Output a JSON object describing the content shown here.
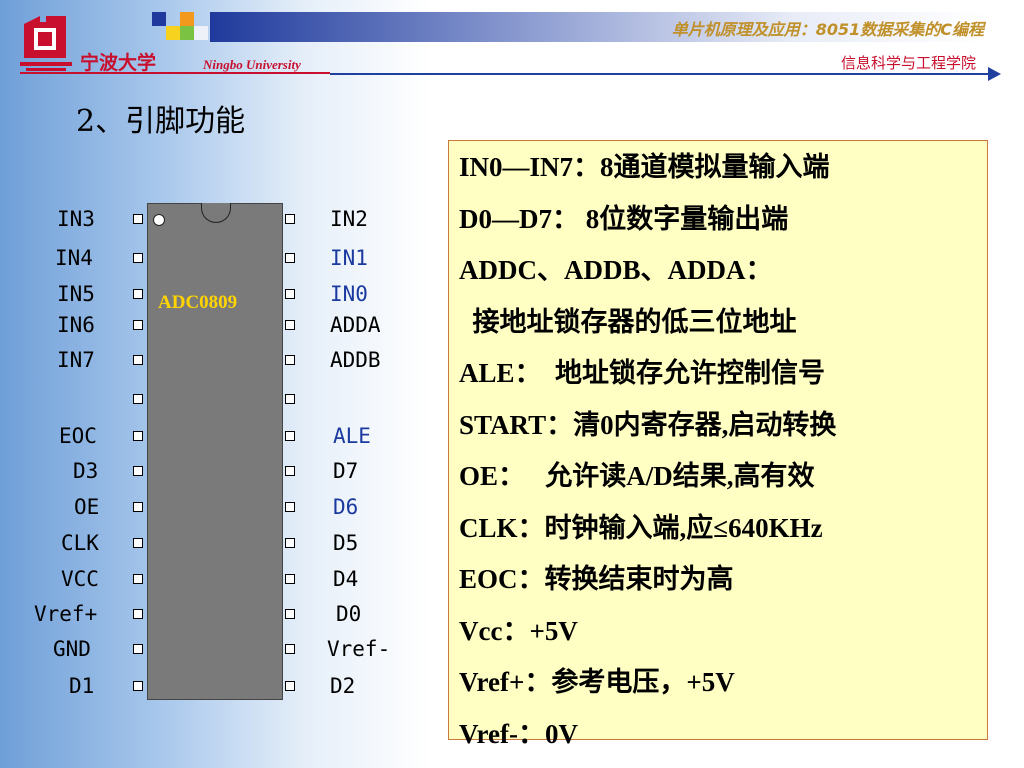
{
  "header": {
    "university_cn": "宁波大学",
    "university_en": "Ningbo University",
    "course_title": "单片机原理及应用：8051数据采集的C编程",
    "college": "信息科学与工程学院",
    "colors": {
      "red": "#c8102e",
      "blue": "#2040a0",
      "gold": "#c0902a"
    }
  },
  "title": "2、引脚功能",
  "chip": {
    "name": "ADC0809",
    "left_pins": [
      "IN3",
      "IN4",
      "IN5",
      "IN6",
      "IN7",
      "",
      "EOC",
      "D3",
      "OE",
      "CLK",
      "VCC",
      "Vref+",
      "GND",
      "D1"
    ],
    "right_pins": [
      "IN2",
      "IN1",
      "IN0",
      "ADDA",
      "ADDB",
      "",
      "ALE",
      "D7",
      "D6",
      "D5",
      "D4",
      "D0",
      "Vref-",
      "D2"
    ]
  },
  "descriptions": [
    "IN0—IN7：8通道模拟量输入端",
    "D0—D7：  8位数字量输出端",
    "ADDC、ADDB、ADDA：",
    "  接地址锁存器的低三位地址",
    "ALE：  地址锁存允许控制信号",
    "START：清0内寄存器,启动转换",
    "OE：   允许读A/D结果,高有效",
    "CLK：时钟输入端,应≤640KHz",
    "EOC：转换结束时为高",
    "Vcc：+5V",
    "Vref+：参考电压，+5V",
    "Vref-：0V"
  ]
}
